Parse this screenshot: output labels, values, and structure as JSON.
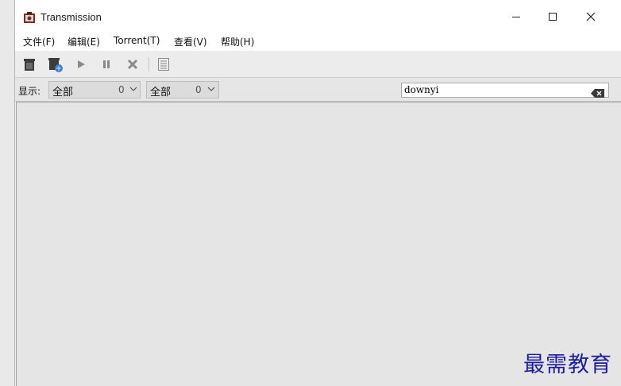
{
  "window": {
    "title": "Transmission",
    "controls": {
      "minimize": "—",
      "maximize": "☐",
      "close": "✕"
    }
  },
  "menu": {
    "items": [
      {
        "label": "文件(F)"
      },
      {
        "label": "编辑(E)"
      },
      {
        "label": "Torrent(T)"
      },
      {
        "label": "查看(V)"
      },
      {
        "label": "帮助(H)"
      }
    ]
  },
  "toolbar": {
    "buttons": [
      {
        "icon": "open-torrent-icon"
      },
      {
        "icon": "add-url-icon"
      },
      {
        "icon": "start-icon"
      },
      {
        "icon": "pause-icon"
      },
      {
        "icon": "remove-icon"
      },
      {
        "icon": "properties-icon"
      }
    ]
  },
  "filter": {
    "show_label": "显示:",
    "activity": {
      "value": "全部",
      "count": "0"
    },
    "tracker": {
      "value": "全部",
      "count": "0"
    },
    "search": {
      "value": "downyi",
      "placeholder": ""
    }
  },
  "watermark": {
    "text": "最需教育"
  }
}
